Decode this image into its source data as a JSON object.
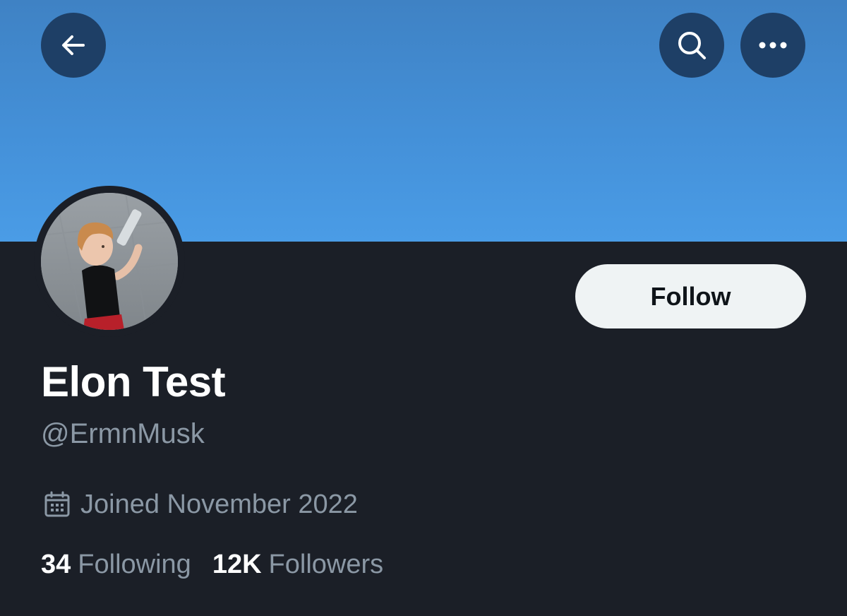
{
  "header": {
    "back_icon": "arrow-left-icon",
    "search_icon": "search-icon",
    "more_icon": "more-horizontal-icon",
    "banner_color": "#4490d8",
    "button_bg": "#1e3f66"
  },
  "profile": {
    "display_name": "Elon Test",
    "handle": "@ErmnMusk",
    "joined": "Joined November 2022",
    "joined_icon": "calendar-icon",
    "follow_label": "Follow",
    "following_count": "34",
    "following_label": "Following",
    "followers_count": "12K",
    "followers_label": "Followers"
  },
  "colors": {
    "background": "#1b1f27",
    "primary_text": "#ffffff",
    "secondary_text": "#8b98a5",
    "follow_button_bg": "#eff3f4",
    "follow_button_text": "#0f1419"
  }
}
